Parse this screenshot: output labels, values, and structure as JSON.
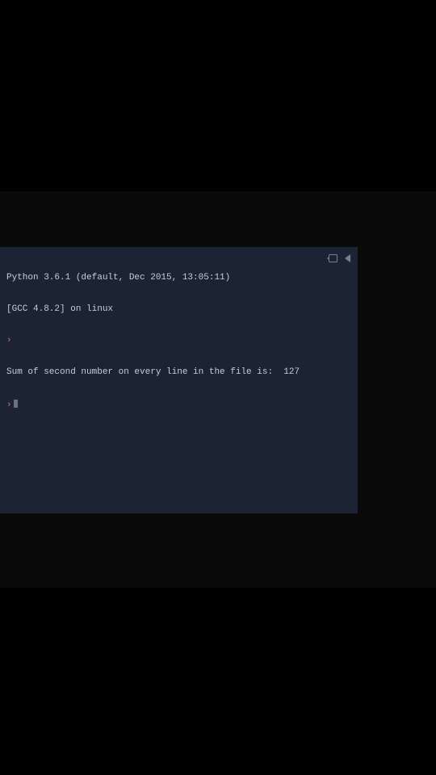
{
  "terminal": {
    "version_line": "Python 3.6.1 (default, Dec 2015, 13:05:11)",
    "compiler_line": "[GCC 4.8.2] on linux",
    "prompt_symbol": "›",
    "output_line": "Sum of second number on every line in the file is:  127"
  }
}
